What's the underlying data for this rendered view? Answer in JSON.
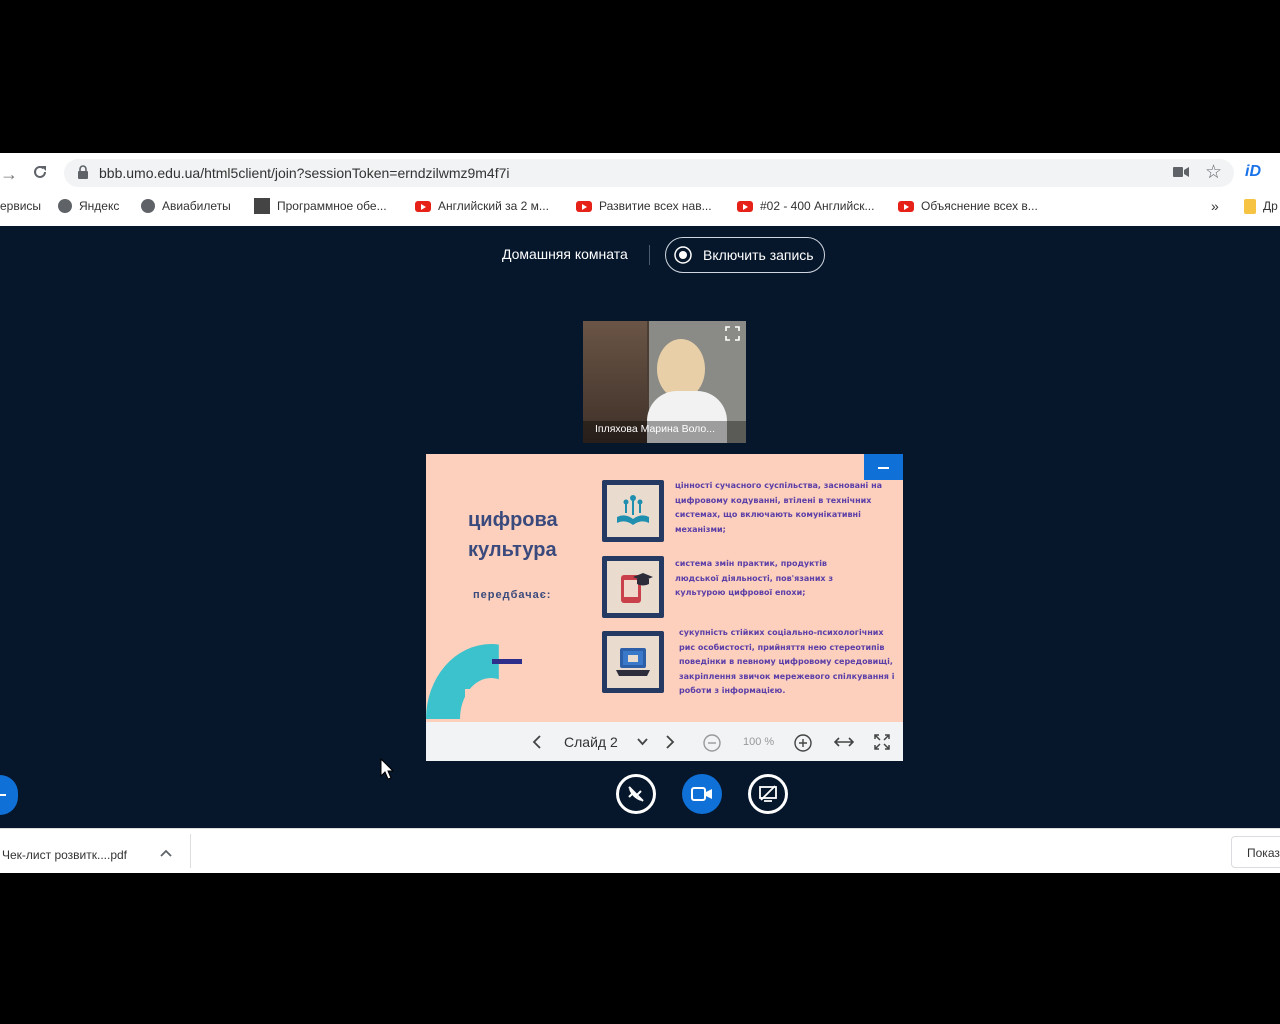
{
  "browser": {
    "url": "bbb.umo.edu.ua/html5client/join?sessionToken=erndzilwmz9m4f7i",
    "bookmarks": [
      {
        "label": "ервисы",
        "icon": "none"
      },
      {
        "label": "Яндекс",
        "icon": "globe-icon"
      },
      {
        "label": "Авиабилеты",
        "icon": "globe-icon"
      },
      {
        "label": "Программное обе...",
        "icon": "app-icon"
      },
      {
        "label": "Английский за 2 м...",
        "icon": "youtube-icon"
      },
      {
        "label": "Развитие всех нав...",
        "icon": "youtube-icon"
      },
      {
        "label": "#02 - 400 Английск...",
        "icon": "youtube-icon"
      },
      {
        "label": "Объяснение всех в...",
        "icon": "youtube-icon"
      }
    ],
    "more_bookmarks": "»",
    "other_bookmarks": "Др"
  },
  "meeting": {
    "room_name": "Домашняя комната",
    "record_label": "Включить запись",
    "webcam_name": "Іпляхова Марина Воло..."
  },
  "slide": {
    "title_line1": "цифрова",
    "title_line2": "культура",
    "subtitle": "передбачає:",
    "point1": "цінності сучасного суспільства, засновані на цифровому кодуванні, втілені в технічних системах, що включають комунікативні механізми;",
    "point2": "система змін практик, продуктів людської діяльності, пов'язаних з культурою цифрової епохи;",
    "point3": "сукупність стійких соціально-психологічних рис особистості, прийняття нею стереотипів поведінки в певному цифровому середовищі, закріплення звичок мережевого спілкування і роботи з інформацією."
  },
  "toolbar": {
    "slide_label": "Слайд 2",
    "zoom": "100 %"
  },
  "download": {
    "file": "Чек-лист розвитк....pdf",
    "show_all": "Показ"
  },
  "colors": {
    "app_bg": "#06172b",
    "accent": "#0f70d7",
    "slide_bg": "#fcd0bd",
    "slide_title": "#3a4a7c",
    "slide_text": "#5b3ea8"
  }
}
